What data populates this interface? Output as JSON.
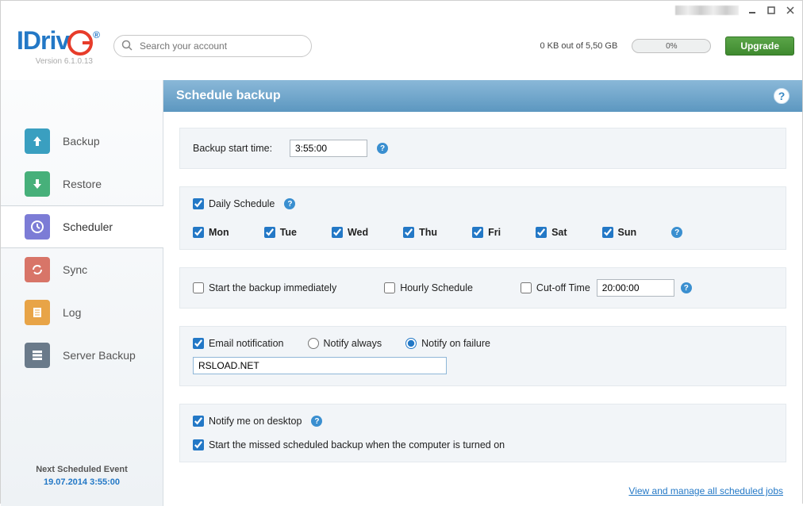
{
  "titlebar": {
    "account_masked": true
  },
  "header": {
    "logo_text": "IDriv",
    "version": "Version  6.1.0.13",
    "search_placeholder": "Search your account",
    "storage_text": "0 KB out of 5,50 GB",
    "meter_pct": "0%",
    "upgrade": "Upgrade"
  },
  "sidebar": {
    "items": [
      {
        "label": "Backup"
      },
      {
        "label": "Restore"
      },
      {
        "label": "Scheduler"
      },
      {
        "label": "Sync"
      },
      {
        "label": "Log"
      },
      {
        "label": "Server Backup"
      }
    ],
    "next_lbl": "Next Scheduled Event",
    "next_time": "19.07.2014 3:55:00"
  },
  "page": {
    "title": "Schedule  backup"
  },
  "schedule": {
    "start_label": "Backup start time:",
    "start_value": "3:55:00",
    "daily_label": "Daily Schedule",
    "daily_checked": true,
    "days": [
      {
        "label": "Mon",
        "checked": true
      },
      {
        "label": "Tue",
        "checked": true
      },
      {
        "label": "Wed",
        "checked": true
      },
      {
        "label": "Thu",
        "checked": true
      },
      {
        "label": "Fri",
        "checked": true
      },
      {
        "label": "Sat",
        "checked": true
      },
      {
        "label": "Sun",
        "checked": true
      }
    ],
    "immediate_label": "Start the backup immediately",
    "immediate_checked": false,
    "hourly_label": "Hourly Schedule",
    "hourly_checked": false,
    "cutoff_label": "Cut-off Time",
    "cutoff_checked": false,
    "cutoff_value": "20:00:00",
    "email_label": "Email notification",
    "email_checked": true,
    "notify_always": "Notify always",
    "notify_failure": "Notify on failure",
    "notify_mode": "failure",
    "email_value": "RSLOAD.NET",
    "desktop_label": "Notify me on desktop",
    "desktop_checked": true,
    "missed_label": "Start the missed scheduled backup when the computer is turned on",
    "missed_checked": true
  },
  "footer": {
    "manage_link": "View and manage all scheduled jobs"
  }
}
